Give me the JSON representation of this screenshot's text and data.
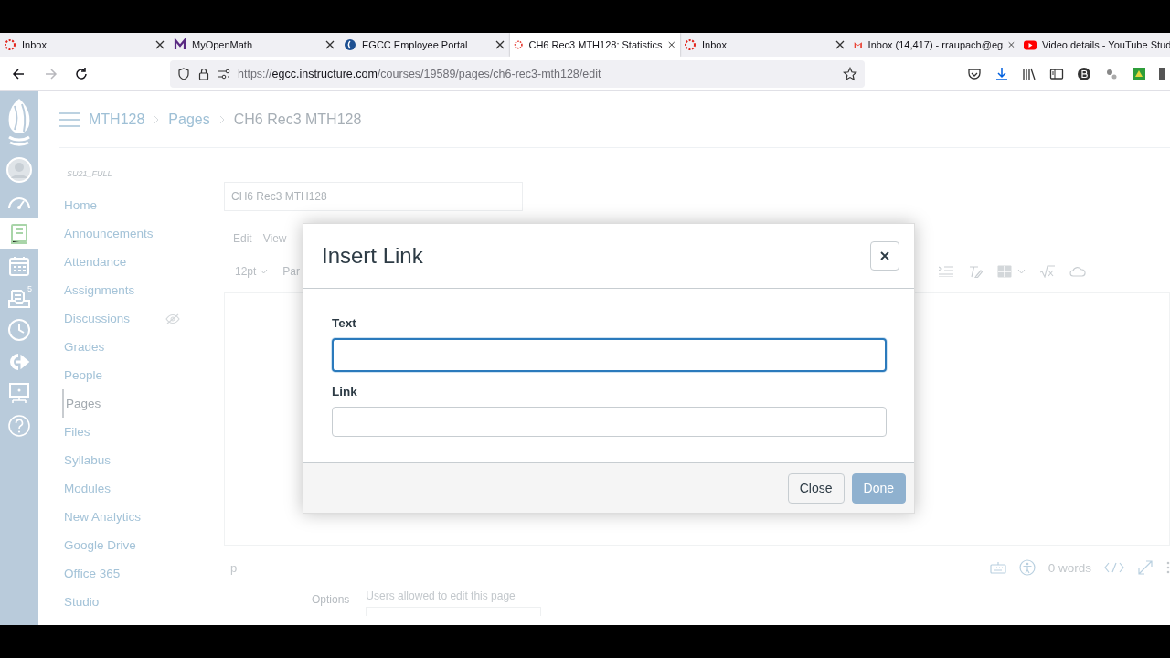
{
  "browser": {
    "tabs": [
      {
        "title": "Inbox",
        "kind": "canvas",
        "selected": false,
        "closable": true
      },
      {
        "title": "MyOpenMath",
        "kind": "letter",
        "selected": false,
        "closable": true
      },
      {
        "title": "EGCC Employee Portal",
        "kind": "portal",
        "selected": false,
        "closable": true
      },
      {
        "title": "CH6 Rec3 MTH128: Statistics",
        "kind": "canvas",
        "selected": true,
        "closable": true
      },
      {
        "title": "Inbox",
        "kind": "canvas",
        "selected": false,
        "closable": true
      },
      {
        "title": "Inbox (14,417) - rraupach@eg",
        "kind": "mail",
        "selected": false,
        "closable": true
      },
      {
        "title": "Video details - YouTube Stud",
        "kind": "video",
        "selected": false,
        "closable": false
      }
    ],
    "nav_buttons": [
      {
        "kind": "back",
        "disabled": false
      },
      {
        "kind": "forward",
        "disabled": true
      },
      {
        "kind": "reload",
        "disabled": false
      }
    ],
    "url": {
      "scheme": "https://",
      "host": "egcc.instructure.com",
      "path": "/courses/19589/pages/ch6-rec3-mth128/edit"
    },
    "bookmarked": false
  },
  "global_nav": {
    "items": [
      {
        "kind": "logo",
        "selected": false
      },
      {
        "kind": "account",
        "selected": false
      },
      {
        "kind": "dashboard",
        "selected": false
      },
      {
        "kind": "courses",
        "selected": true
      },
      {
        "kind": "calendar",
        "selected": false
      },
      {
        "kind": "inbox",
        "selected": false,
        "badge": "5"
      },
      {
        "kind": "history",
        "selected": false
      },
      {
        "kind": "commons",
        "selected": false
      },
      {
        "kind": "studio",
        "selected": false
      },
      {
        "kind": "help",
        "selected": false
      }
    ]
  },
  "breadcrumbs": [
    "MTH128",
    "Pages",
    "CH6 Rec3 MTH128"
  ],
  "course_nav": {
    "term": "SU21_FULL",
    "items": [
      {
        "label": "Home",
        "selected": false,
        "hidden": false
      },
      {
        "label": "Announcements",
        "selected": false,
        "hidden": false
      },
      {
        "label": "Attendance",
        "selected": false,
        "hidden": false
      },
      {
        "label": "Assignments",
        "selected": false,
        "hidden": false
      },
      {
        "label": "Discussions",
        "selected": false,
        "hidden": true
      },
      {
        "label": "Grades",
        "selected": false,
        "hidden": false
      },
      {
        "label": "People",
        "selected": false,
        "hidden": false
      },
      {
        "label": "Pages",
        "selected": true,
        "hidden": false
      },
      {
        "label": "Files",
        "selected": false,
        "hidden": false
      },
      {
        "label": "Syllabus",
        "selected": false,
        "hidden": false
      },
      {
        "label": "Modules",
        "selected": false,
        "hidden": false
      },
      {
        "label": "New Analytics",
        "selected": false,
        "hidden": false
      },
      {
        "label": "Google Drive",
        "selected": false,
        "hidden": false
      },
      {
        "label": "Office 365",
        "selected": false,
        "hidden": false
      },
      {
        "label": "Studio",
        "selected": false,
        "hidden": false
      }
    ]
  },
  "editor": {
    "title_value": "CH6 Rec3 MTH128",
    "menu": [
      "Edit",
      "View"
    ],
    "font_size": "12pt",
    "block_format": "Par",
    "path": "p",
    "word_count": "0 words"
  },
  "options": {
    "label": "Options",
    "hint": "Users allowed to edit this page"
  },
  "dialog": {
    "title": "Insert Link",
    "fields": [
      {
        "label": "Text",
        "focused": true
      },
      {
        "label": "Link",
        "focused": false
      }
    ],
    "buttons": [
      {
        "label": "Close",
        "kind": "secondary"
      },
      {
        "label": "Done",
        "kind": "primary"
      }
    ]
  }
}
